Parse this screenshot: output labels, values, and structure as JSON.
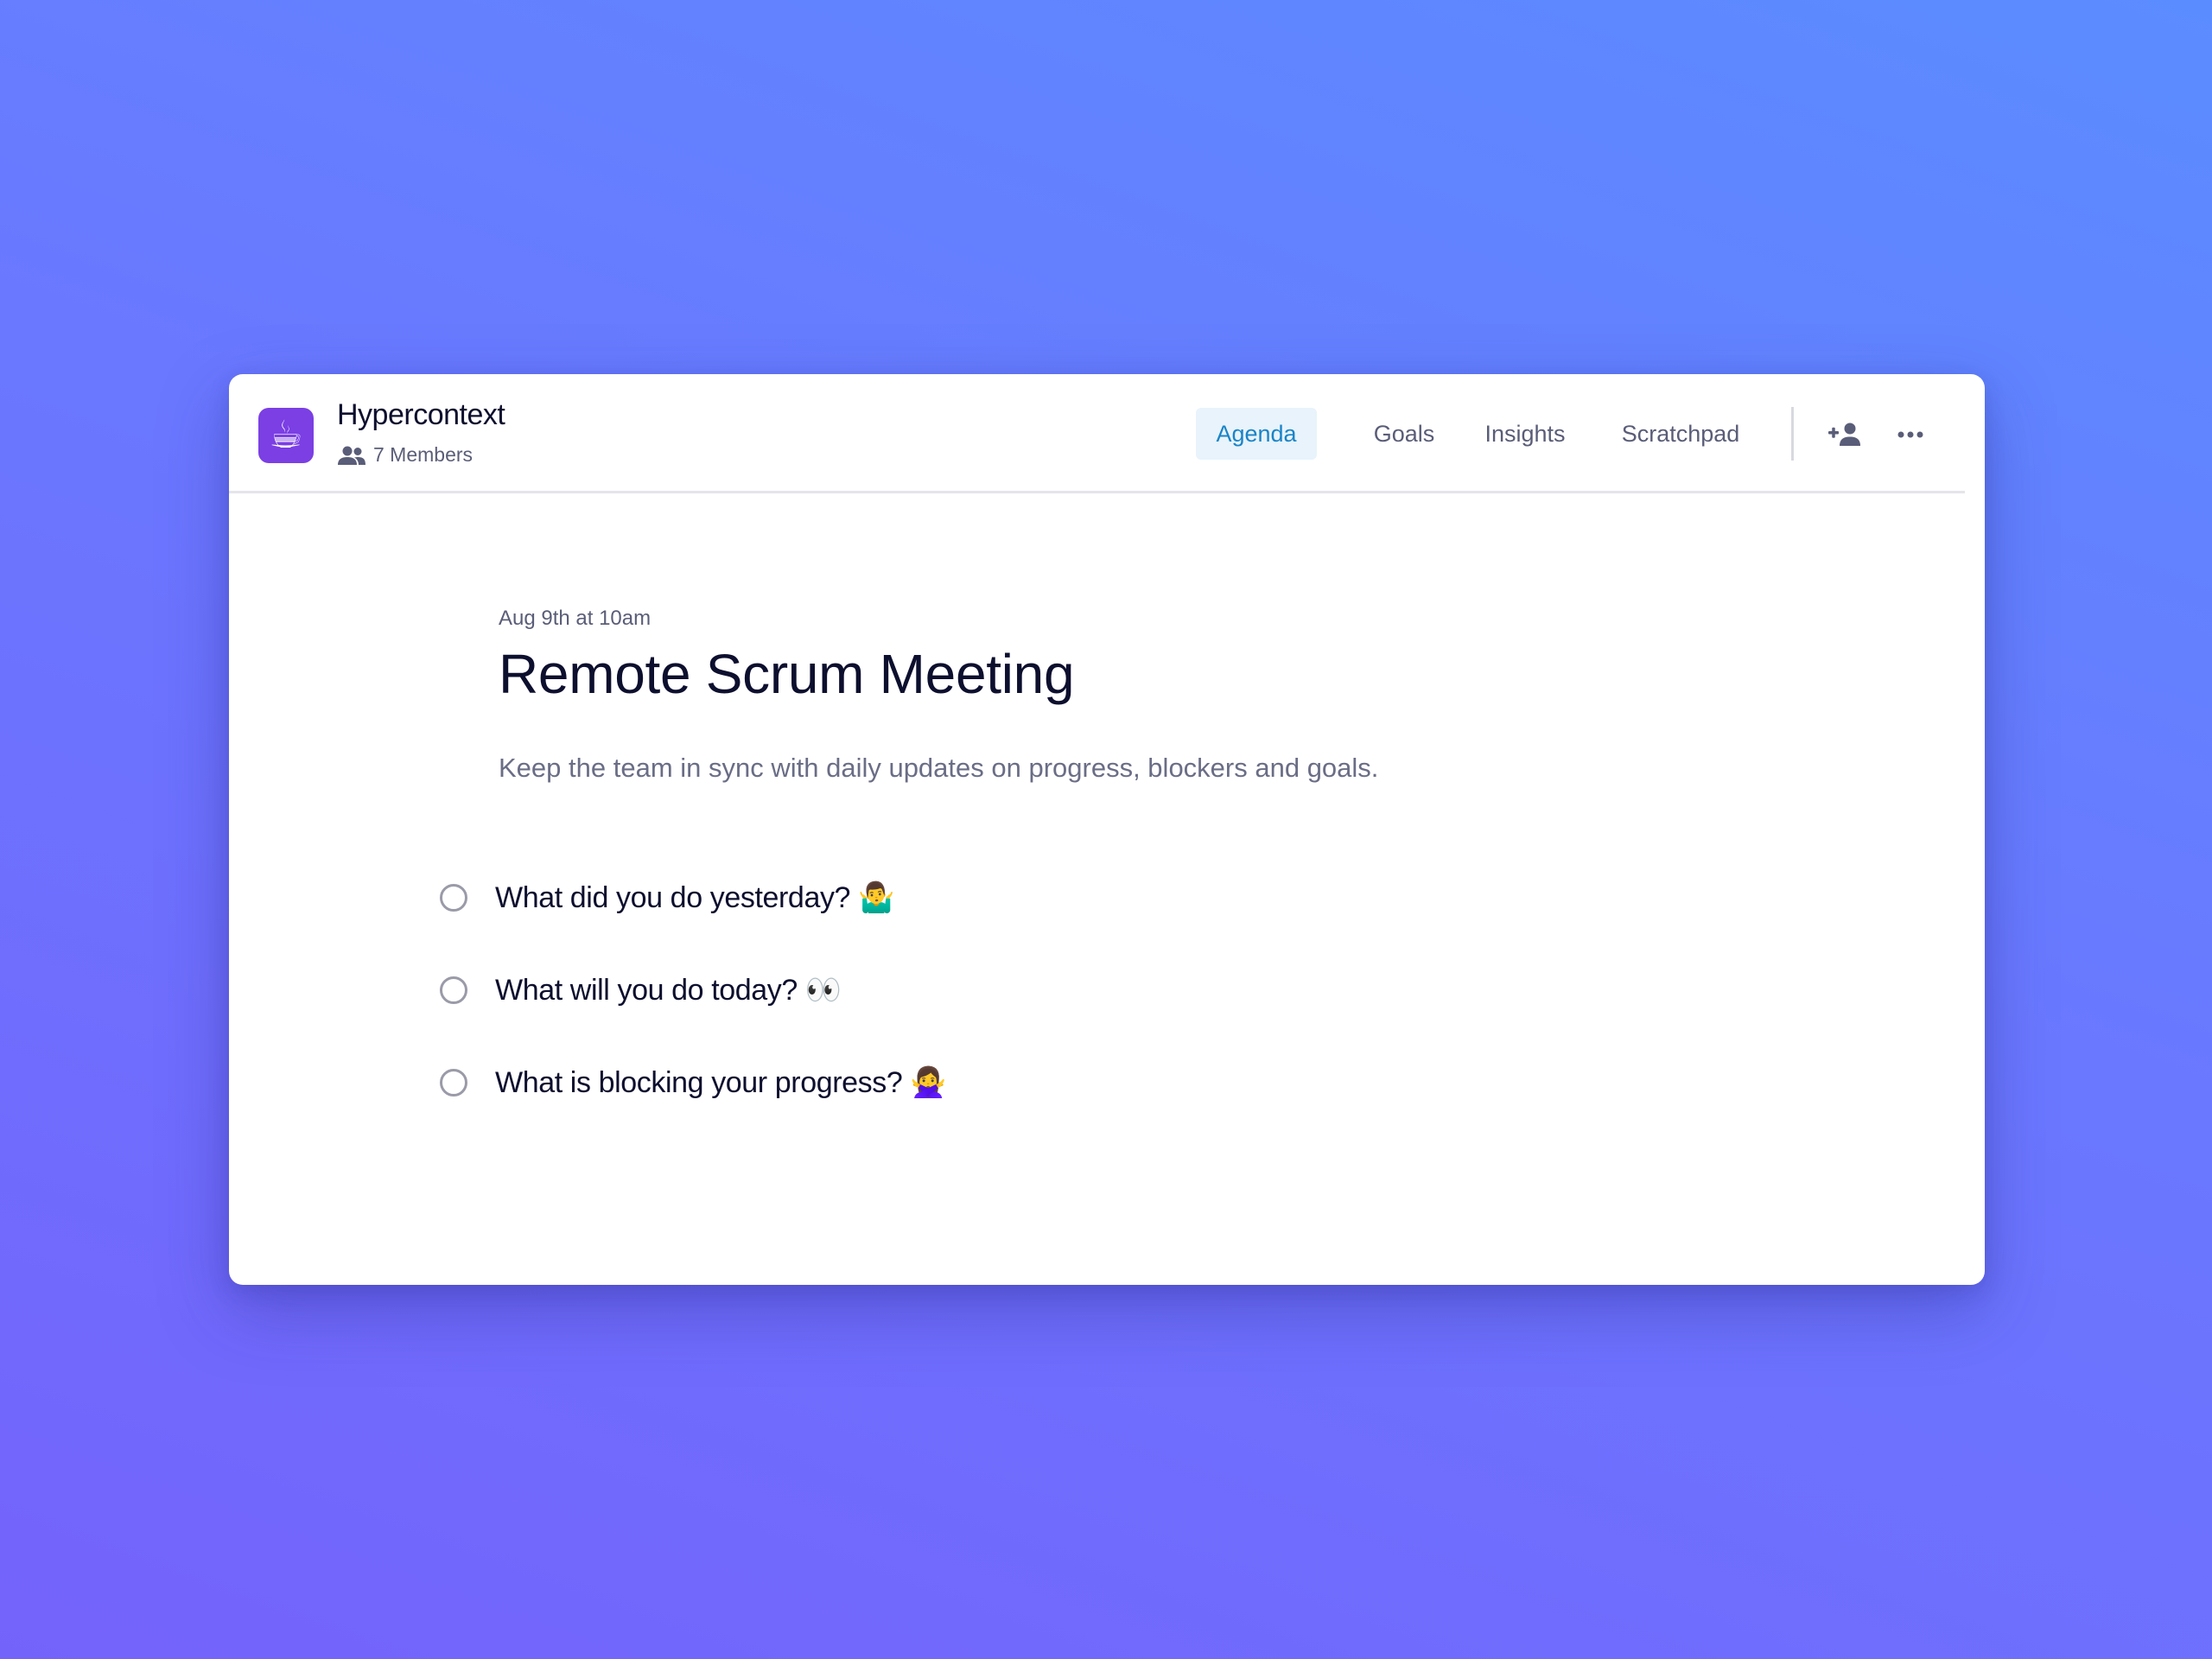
{
  "app": {
    "name": "Hypercontext",
    "icon": "coffee-cup-icon",
    "icon_glyph": "☕",
    "icon_bg": "#7b3fe4",
    "members_label": "7 Members"
  },
  "tabs": [
    {
      "label": "Agenda",
      "active": true
    },
    {
      "label": "Goals",
      "active": false
    },
    {
      "label": "Insights",
      "active": false
    },
    {
      "label": "Scratchpad",
      "active": false
    }
  ],
  "header_actions": {
    "add_member_icon": "add-person-icon",
    "more_icon": "more-horizontal-icon"
  },
  "meeting": {
    "date": "Aug 9th at 10am",
    "title": "Remote Scrum Meeting",
    "description": "Keep the team in sync with daily updates on progress, blockers and goals."
  },
  "agenda_items": [
    {
      "text": "What did you do yesterday? 🤷‍♂️",
      "checked": false
    },
    {
      "text": "What will you do today? 👀",
      "checked": false
    },
    {
      "text": "What is blocking your progress? 🙅‍♀️",
      "checked": false
    }
  ],
  "colors": {
    "background_start": "#5b8cff",
    "background_end": "#7463fb",
    "active_tab_bg": "#e8f3fb",
    "active_tab_text": "#1a84c7",
    "heading_text": "#0d0f2e",
    "muted_text": "#5a5d78"
  }
}
